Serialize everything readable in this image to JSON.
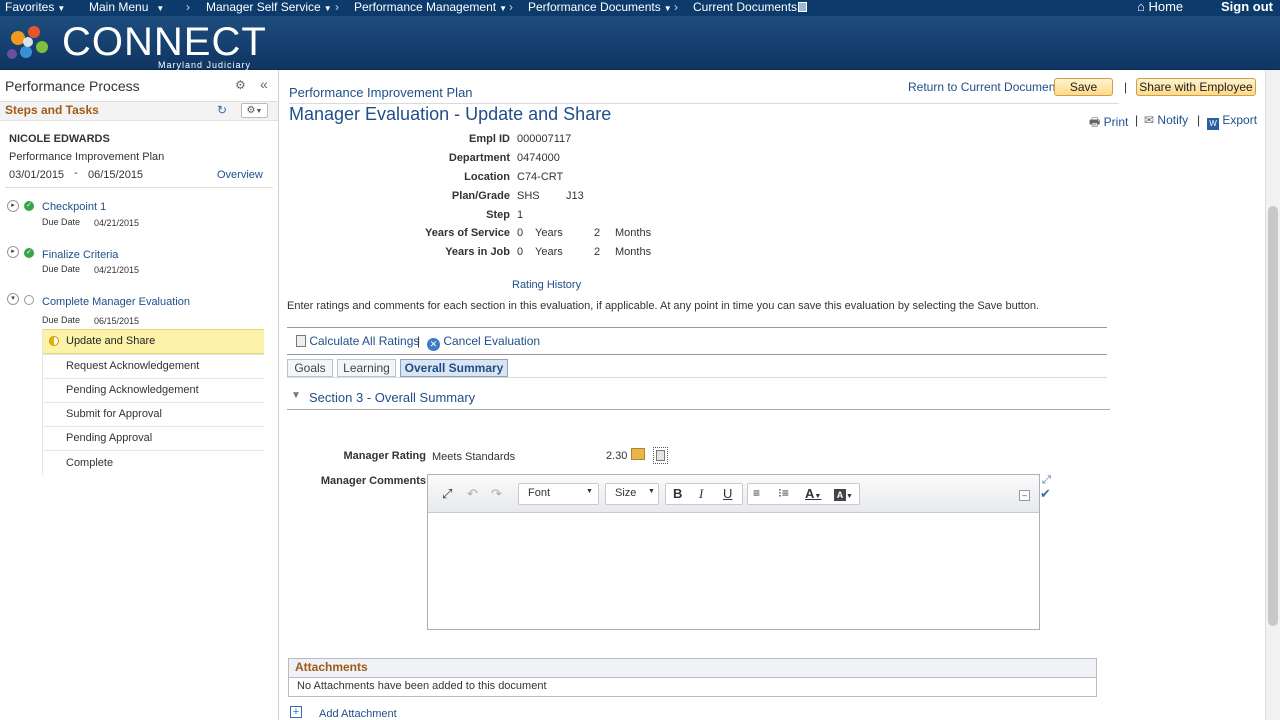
{
  "nav": {
    "favorites": "Favorites",
    "main_menu": "Main Menu",
    "manager_self_service": "Manager Self Service",
    "performance_management": "Performance Management",
    "performance_documents": "Performance Documents",
    "current_documents": "Current Documents",
    "home": "Home",
    "sign_out": "Sign out"
  },
  "banner": {
    "logo": "CONNECT",
    "subtitle": "Maryland Judiciary"
  },
  "sidebar": {
    "title": "Performance Process",
    "steps_title": "Steps and Tasks",
    "employee_name": "NICOLE EDWARDS",
    "plan": "Performance Improvement Plan",
    "start_date": "03/01/2015",
    "dash": "-",
    "end_date": "06/15/2015",
    "overview": "Overview",
    "due_label": "Due Date",
    "steps": [
      {
        "name": "Checkpoint 1",
        "due": "04/21/2015"
      },
      {
        "name": "Finalize Criteria",
        "due": "04/21/2015"
      },
      {
        "name": "Complete Manager Evaluation",
        "due": "06/15/2015"
      }
    ],
    "subtasks": [
      "Update and Share",
      "Request Acknowledgement",
      "Pending Acknowledgement",
      "Submit for Approval",
      "Pending Approval",
      "Complete"
    ]
  },
  "content": {
    "doc_type": "Performance Improvement Plan",
    "page_title": "Manager Evaluation - Update and Share",
    "return_link": "Return to Current Documents",
    "save": "Save",
    "pipe": "|",
    "share": "Share with Employee",
    "print": "Print",
    "notify": "Notify",
    "export": "Export",
    "fields": {
      "empl_id_label": "Empl ID",
      "empl_id": "000007117",
      "dept_label": "Department",
      "dept": "0474000",
      "location_label": "Location",
      "location": "C74-CRT",
      "plan_grade_label": "Plan/Grade",
      "plan": "SHS",
      "grade": "J13",
      "step_label": "Step",
      "step": "1",
      "yos_label": "Years of Service",
      "yos_years": "0",
      "yos_months": "2",
      "yij_label": "Years in Job",
      "yij_years": "0",
      "yij_months": "2",
      "years_word": "Years",
      "months_word": "Months"
    },
    "rating_history": "Rating History",
    "instructions": "Enter ratings and comments for each section in this evaluation, if applicable. At any point in time you can save this evaluation by selecting the Save button.",
    "calc_all": "Calculate All Ratings",
    "cancel_eval": "Cancel Evaluation",
    "tabs": [
      "Goals",
      "Learning",
      "Overall Summary"
    ],
    "section_title": "Section 3 - Overall Summary",
    "manager_rating_label": "Manager Rating",
    "manager_rating": "Meets Standards",
    "rating_value": "2.30",
    "manager_comments_label": "Manager Comments",
    "font_label": "Font",
    "size_label": "Size",
    "attachments_title": "Attachments",
    "no_attachments": "No Attachments have been added to this document",
    "add_attachment": "Add Attachment"
  },
  "colors": {
    "accent": "#1f4f8a",
    "header": "#0b3a6b",
    "section": "#a15a17",
    "highlight": "#fdf3a8"
  }
}
